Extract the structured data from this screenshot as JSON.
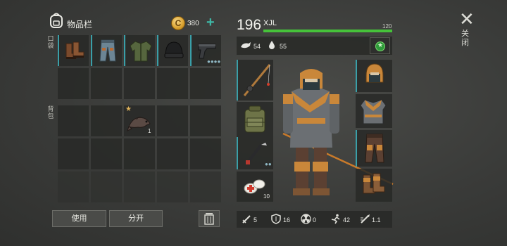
{
  "inventory": {
    "title": "物品栏",
    "coins": "380",
    "pockets_label": "口袋",
    "backpack_label": "背包",
    "pocket_items": [
      "boots-icon",
      "pants-icon",
      "jacket-icon",
      "beanie-icon",
      "pistol-icon"
    ],
    "backpack_item_count": "1",
    "use_button": "使用",
    "split_button": "分开"
  },
  "character": {
    "level": "196",
    "name": "XJL",
    "hp_max": "120",
    "hp_fraction": 1.0,
    "food": "54",
    "water": "55",
    "bandage_count": "10"
  },
  "stats": {
    "attack": "5",
    "defense": "16",
    "radiation": "0",
    "speed": "42",
    "damage_mult": "1.1"
  },
  "close_label": "关闭",
  "colors": {
    "accent": "#3fb9a8",
    "hp": "#46c23a",
    "slot_highlight": "#3a9fa8",
    "armor_orange": "#c9873a"
  }
}
